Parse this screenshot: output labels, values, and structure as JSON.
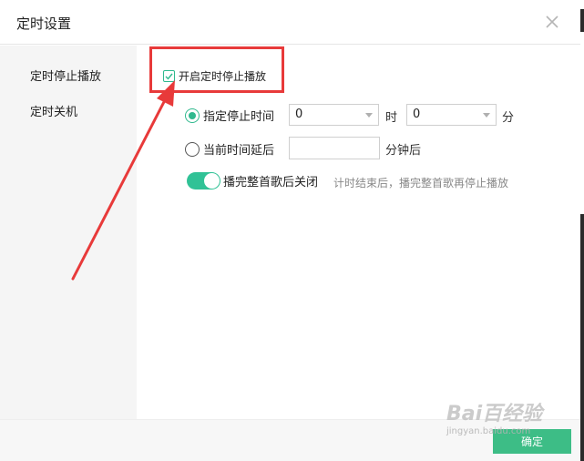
{
  "dialog": {
    "title": "定时设置",
    "close_icon": "close-icon"
  },
  "sidebar": {
    "items": [
      {
        "label": "定时停止播放",
        "selected": true
      },
      {
        "label": "定时关机",
        "selected": false
      }
    ]
  },
  "content": {
    "enable_checkbox": {
      "label": "开启定时停止播放",
      "checked": true
    },
    "specify_time": {
      "label": "指定停止时间",
      "checked": true,
      "hour_value": "0",
      "hour_unit": "时",
      "minute_value": "0",
      "minute_unit": "分"
    },
    "delay": {
      "label": "当前时间延后",
      "checked": false,
      "value": "",
      "unit": "分钟后"
    },
    "finish_song": {
      "label": "播完整首歌后关闭",
      "on": true,
      "hint": "计时结束后，播完整首歌再停止播放"
    }
  },
  "footer": {
    "confirm_label": "确定"
  },
  "watermark": {
    "main": "Bai百经验",
    "sub": "jingyan.baidu.com"
  },
  "colors": {
    "accent": "#30b98e",
    "annotation_red": "#e83a3a",
    "button_green": "#3dbd86"
  }
}
